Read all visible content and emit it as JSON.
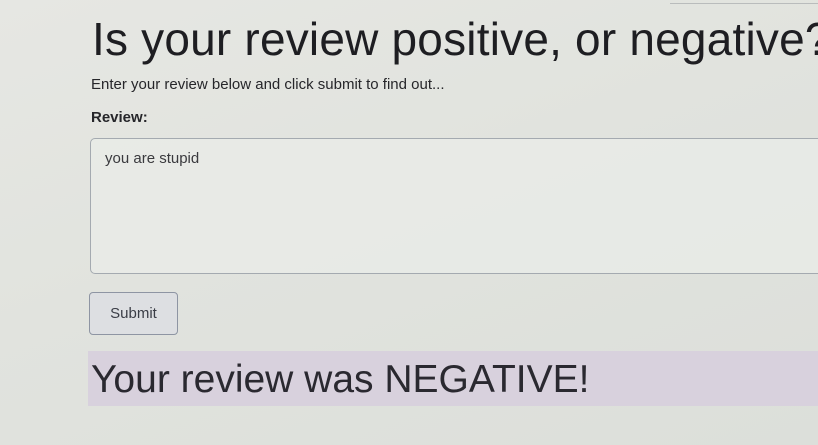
{
  "page": {
    "title": "Is your review positive, or negative?",
    "subtitle": "Enter your review below and click submit to find out..."
  },
  "form": {
    "review_label": "Review:",
    "review_value": "you are stupid",
    "submit_label": "Submit"
  },
  "result": {
    "text": "Your review was NEGATIVE!"
  },
  "colors": {
    "background": "#e3e5e0",
    "result_banner": "#d8d1dd",
    "button_border": "#8e95a3",
    "text": "#232327"
  }
}
